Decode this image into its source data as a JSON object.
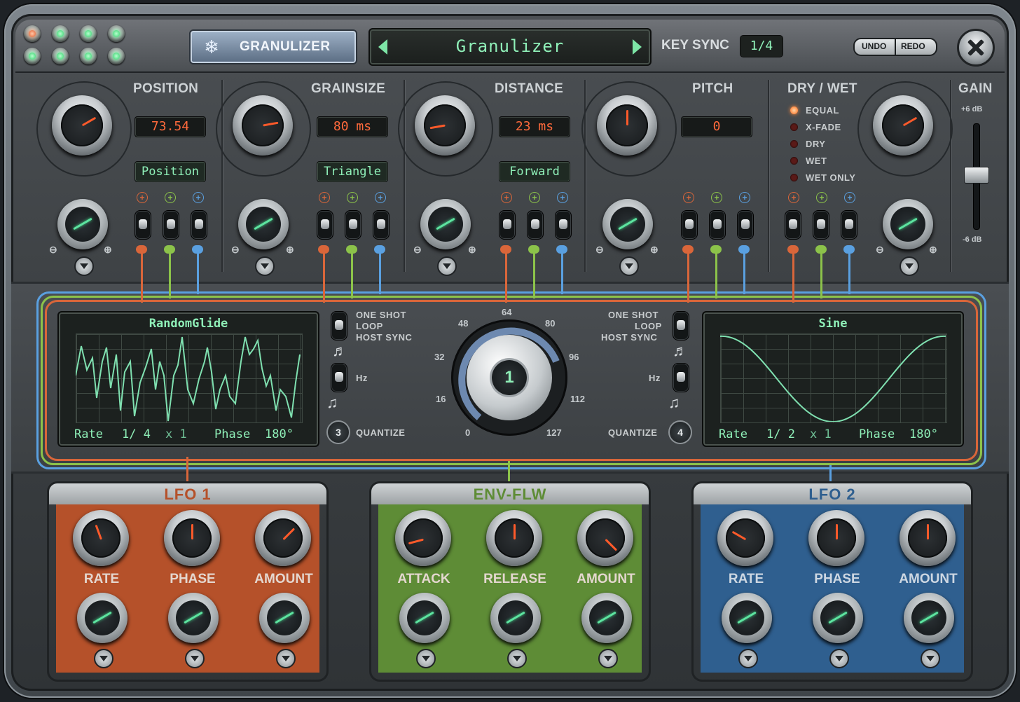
{
  "header": {
    "plugin_button": "GRANULIZER",
    "preset_name": "Granulizer",
    "key_sync_label": "KEY SYNC",
    "key_sync_value": "1/4",
    "undo": "UNDO",
    "redo": "REDO"
  },
  "params": [
    {
      "title": "POSITION",
      "value": "73.54",
      "mode": "Position"
    },
    {
      "title": "GRAINSIZE",
      "value": "80 ms",
      "mode": "Triangle"
    },
    {
      "title": "DISTANCE",
      "value": "23 ms",
      "mode": "Forward"
    },
    {
      "title": "PITCH",
      "value": "0",
      "mode": ""
    }
  ],
  "dry_wet": {
    "title": "DRY / WET",
    "options": [
      "EQUAL",
      "X-FADE",
      "DRY",
      "WET",
      "WET ONLY"
    ],
    "selected": "EQUAL"
  },
  "gain": {
    "title": "GAIN",
    "max": "+6 dB",
    "min": "-6 dB"
  },
  "lfo_left": {
    "waveform": "RandomGlide",
    "rate_label": "Rate",
    "rate": "1/ 4",
    "mult": "x 1",
    "phase_label": "Phase",
    "phase": "180°",
    "options": [
      "ONE SHOT",
      "LOOP",
      "HOST SYNC"
    ],
    "hz": "Hz",
    "quantize_label": "QUANTIZE",
    "quantize": "3"
  },
  "lfo_right": {
    "waveform": "Sine",
    "rate_label": "Rate",
    "rate": "1/ 2",
    "mult": "x 1",
    "phase_label": "Phase",
    "phase": "180°",
    "options": [
      "ONE SHOT",
      "LOOP",
      "HOST SYNC"
    ],
    "hz": "Hz",
    "quantize_label": "QUANTIZE",
    "quantize": "4"
  },
  "center_dial": {
    "value": "1",
    "scale": [
      "0",
      "16",
      "32",
      "48",
      "64",
      "80",
      "96",
      "112",
      "127"
    ]
  },
  "modules": [
    {
      "title": "LFO 1",
      "color": "#b5512a",
      "knobs": [
        "RATE",
        "PHASE",
        "AMOUNT"
      ]
    },
    {
      "title": "ENV-FLW",
      "color": "#5e8c36",
      "knobs": [
        "ATTACK",
        "RELEASE",
        "AMOUNT"
      ]
    },
    {
      "title": "LFO 2",
      "color": "#2f5f8f",
      "knobs": [
        "RATE",
        "PHASE",
        "AMOUNT"
      ]
    }
  ],
  "colors": {
    "mod1": "#d9663a",
    "mod2": "#8cc34a",
    "mod3": "#5aa0e0",
    "lcd_green": "#8ff0b8",
    "lcd_orange": "#ff6a3c"
  }
}
